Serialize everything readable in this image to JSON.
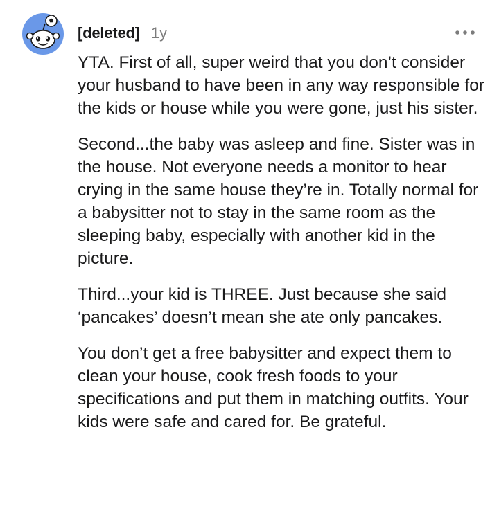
{
  "comment": {
    "author": "[deleted]",
    "age": "1y",
    "avatar_icon": "snoo-avatar-icon",
    "more_icon": "more-options-icon",
    "paragraphs": [
      "YTA. First of all, super weird that you don’t consider your husband to have been in any way responsible for the kids or house while you were gone, just his sister.",
      "Second...the baby was asleep and fine. Sister was in the house. Not everyone needs a monitor to hear crying in the same house they’re in. Totally normal for a babysitter not to stay in the same room as the sleeping baby, especially with another kid in the picture.",
      "Third...your kid is THREE. Just because she said ‘pancakes’ doesn’t mean she ate only pancakes.",
      "You don’t get a free babysitter and expect them to clean your house, cook fresh foods to your specifications and put them in matching outfits. Your kids were safe and cared for. Be grateful."
    ]
  },
  "colors": {
    "avatar_bg": "#6a98e8",
    "text": "#1a1a1b",
    "meta": "#7c7c7c"
  }
}
